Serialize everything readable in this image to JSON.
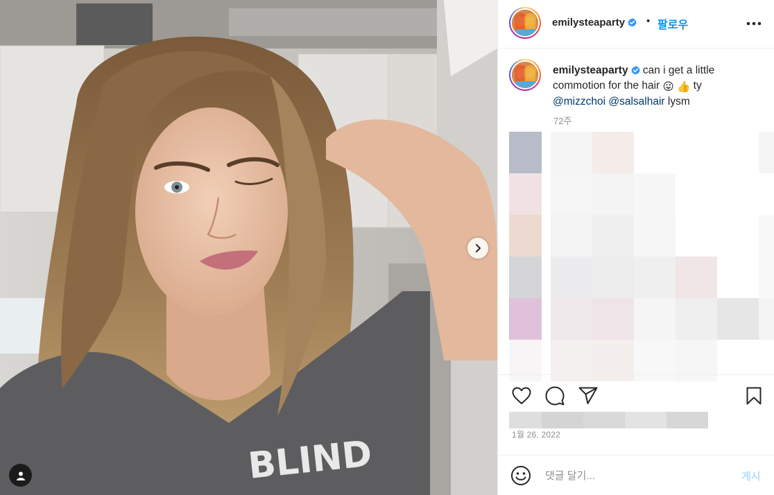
{
  "post": {
    "username": "emilysteaparty",
    "dot": "•",
    "follow_label": "팔로우",
    "caption_line1_text": "can i get a little",
    "caption_line2_text": "commotion for the hair",
    "caption_emoji_1": "😛",
    "caption_emoji_2": "👍",
    "caption_ty": "ty",
    "mention_1": "@mizzchoi",
    "mention_2": "@salsalhair",
    "caption_end": "lysm",
    "time_ago": "72주",
    "date": "1월 26, 2022",
    "photo_text": "BLIND"
  },
  "comment": {
    "placeholder": "댓글 달기...",
    "post_label": "게시"
  },
  "icons": {
    "header_more": "more-horizontal-icon",
    "verified": "verified-badge-icon",
    "like": "heart-icon",
    "comment": "comment-bubble-icon",
    "share": "paper-plane-icon",
    "save": "bookmark-icon",
    "emoji": "smiley-icon",
    "next": "chevron-right-icon",
    "tagged": "user-tag-icon"
  },
  "colors": {
    "accent": "#0095f6",
    "verified": "#3897f0",
    "mention": "#00376b",
    "muted": "#8e8e8e",
    "post_disabled": "#b2dffc"
  }
}
